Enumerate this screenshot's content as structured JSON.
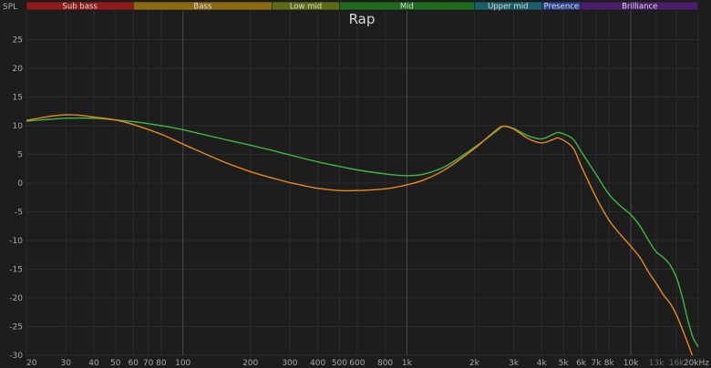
{
  "chart_data": {
    "type": "line",
    "title": "Rap",
    "ylabel": "SPL",
    "xscale": "log",
    "xlim": [
      20,
      20000
    ],
    "ylim": [
      -30,
      30
    ],
    "grid": true,
    "x_ticks": [
      {
        "value": 20,
        "label": "20"
      },
      {
        "value": 30,
        "label": "30"
      },
      {
        "value": 40,
        "label": "40"
      },
      {
        "value": 50,
        "label": "50"
      },
      {
        "value": 60,
        "label": "60"
      },
      {
        "value": 70,
        "label": "70"
      },
      {
        "value": 80,
        "label": "80"
      },
      {
        "value": 100,
        "label": "100"
      },
      {
        "value": 200,
        "label": "200"
      },
      {
        "value": 300,
        "label": "300"
      },
      {
        "value": 400,
        "label": "400"
      },
      {
        "value": 500,
        "label": "500"
      },
      {
        "value": 600,
        "label": "600"
      },
      {
        "value": 800,
        "label": "800"
      },
      {
        "value": 1000,
        "label": "1k"
      },
      {
        "value": 2000,
        "label": "2k"
      },
      {
        "value": 3000,
        "label": "3k"
      },
      {
        "value": 4000,
        "label": "4k"
      },
      {
        "value": 5000,
        "label": "5k"
      },
      {
        "value": 6000,
        "label": "6k"
      },
      {
        "value": 7000,
        "label": "7k"
      },
      {
        "value": 8000,
        "label": "8k"
      },
      {
        "value": 10000,
        "label": "10k"
      },
      {
        "value": 13000,
        "label": "13k",
        "dim": true
      },
      {
        "value": 16000,
        "label": "16k",
        "dim": true
      },
      {
        "value": 20000,
        "label": "20kHz"
      }
    ],
    "y_ticks": [
      {
        "value": 25,
        "label": "25"
      },
      {
        "value": 20,
        "label": "20"
      },
      {
        "value": 15,
        "label": "15"
      },
      {
        "value": 10,
        "label": "10"
      },
      {
        "value": 5,
        "label": "5"
      },
      {
        "value": 0,
        "label": "0"
      },
      {
        "value": -5,
        "label": "-5"
      },
      {
        "value": -10,
        "label": "-10"
      },
      {
        "value": -15,
        "label": "-15"
      },
      {
        "value": -20,
        "label": "-20"
      },
      {
        "value": -25,
        "label": "-25"
      },
      {
        "value": -30,
        "label": "-30"
      }
    ],
    "bands": [
      {
        "label": "Sub bass",
        "from": 20,
        "to": 60,
        "color": "#8e1a1a"
      },
      {
        "label": "Bass",
        "from": 60,
        "to": 250,
        "color": "#8a6a12"
      },
      {
        "label": "Low mid",
        "from": 250,
        "to": 500,
        "color": "#5e6a14"
      },
      {
        "label": "Mid",
        "from": 500,
        "to": 2000,
        "color": "#1f6a1f"
      },
      {
        "label": "Upper mid",
        "from": 2000,
        "to": 4000,
        "color": "#1a5e6a"
      },
      {
        "label": "Presence",
        "from": 4000,
        "to": 6000,
        "color": "#2a3f8a"
      },
      {
        "label": "Brilliance",
        "from": 6000,
        "to": 20000,
        "color": "#4a1f6a"
      }
    ],
    "series": [
      {
        "color": "#3fb83f",
        "points": [
          [
            20,
            10.8
          ],
          [
            30,
            11.3
          ],
          [
            40,
            11.3
          ],
          [
            50,
            11.0
          ],
          [
            60,
            10.7
          ],
          [
            80,
            10.0
          ],
          [
            100,
            9.3
          ],
          [
            150,
            7.7
          ],
          [
            200,
            6.6
          ],
          [
            250,
            5.7
          ],
          [
            300,
            4.9
          ],
          [
            400,
            3.7
          ],
          [
            500,
            2.9
          ],
          [
            600,
            2.3
          ],
          [
            800,
            1.6
          ],
          [
            1000,
            1.3
          ],
          [
            1200,
            1.6
          ],
          [
            1500,
            3.0
          ],
          [
            2000,
            6.2
          ],
          [
            2500,
            9.0
          ],
          [
            2700,
            9.9
          ],
          [
            3000,
            9.5
          ],
          [
            3500,
            8.2
          ],
          [
            4000,
            7.7
          ],
          [
            4500,
            8.5
          ],
          [
            4800,
            8.8
          ],
          [
            5500,
            7.7
          ],
          [
            6000,
            5.5
          ],
          [
            7000,
            1.5
          ],
          [
            8000,
            -2.0
          ],
          [
            9000,
            -4.0
          ],
          [
            10000,
            -5.5
          ],
          [
            11000,
            -7.5
          ],
          [
            12000,
            -10.0
          ],
          [
            13000,
            -12.0
          ],
          [
            14000,
            -13.0
          ],
          [
            15000,
            -14.3
          ],
          [
            16000,
            -16.5
          ],
          [
            17000,
            -20.0
          ],
          [
            18000,
            -24.0
          ],
          [
            19000,
            -27.0
          ],
          [
            20000,
            -28.5
          ]
        ]
      },
      {
        "color": "#e68a1a",
        "points": [
          [
            20,
            10.9
          ],
          [
            25,
            11.6
          ],
          [
            30,
            11.9
          ],
          [
            35,
            11.8
          ],
          [
            40,
            11.5
          ],
          [
            50,
            11.0
          ],
          [
            60,
            10.2
          ],
          [
            80,
            8.5
          ],
          [
            100,
            6.8
          ],
          [
            150,
            3.8
          ],
          [
            200,
            2.0
          ],
          [
            250,
            0.9
          ],
          [
            300,
            0.1
          ],
          [
            400,
            -0.9
          ],
          [
            500,
            -1.3
          ],
          [
            600,
            -1.3
          ],
          [
            800,
            -1.0
          ],
          [
            1000,
            -0.3
          ],
          [
            1200,
            0.6
          ],
          [
            1500,
            2.5
          ],
          [
            2000,
            6.0
          ],
          [
            2500,
            9.2
          ],
          [
            2700,
            9.9
          ],
          [
            3000,
            9.4
          ],
          [
            3500,
            7.7
          ],
          [
            4000,
            7.0
          ],
          [
            4500,
            7.6
          ],
          [
            4800,
            7.8
          ],
          [
            5500,
            6.2
          ],
          [
            6000,
            3.0
          ],
          [
            7000,
            -2.5
          ],
          [
            8000,
            -6.5
          ],
          [
            9000,
            -9.0
          ],
          [
            10000,
            -11.0
          ],
          [
            11000,
            -13.0
          ],
          [
            12000,
            -15.5
          ],
          [
            13000,
            -17.5
          ],
          [
            14000,
            -19.5
          ],
          [
            15000,
            -21.0
          ],
          [
            16000,
            -23.0
          ],
          [
            17000,
            -25.5
          ],
          [
            18000,
            -28.0
          ],
          [
            18800,
            -30.0
          ]
        ]
      }
    ]
  }
}
